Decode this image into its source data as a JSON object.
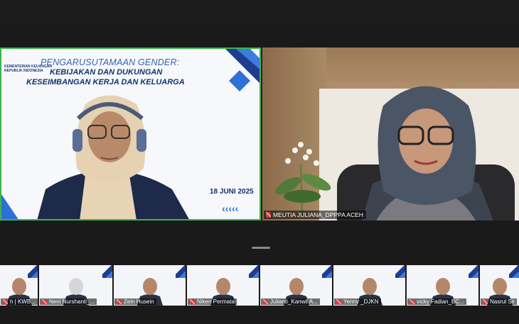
{
  "main_tiles": {
    "left": {
      "slide_line1": "PENGARUSUTAMAAN GENDER:",
      "slide_line2": "KEBIJAKAN DAN DUKUNGAN",
      "slide_line3": "KESEIMBANGAN KERJA DAN KELUARGA",
      "slide_logo": "KEMENTERIAN KEUANGAN",
      "slide_logo_sub": "REPUBLIK INDONESIA",
      "slide_date": "18 JUNI 2025"
    },
    "right": {
      "name": "MEUTIA JULIANA_DPPPA ACEH"
    }
  },
  "thumbnails": [
    {
      "name": "h | KWB..."
    },
    {
      "name": "Neni Nurshanti_..."
    },
    {
      "name": "Zein Husein"
    },
    {
      "name": "Niken Permata"
    },
    {
      "name": "Julianti_Kanwil A..."
    },
    {
      "name": "Yenny _DJKN"
    },
    {
      "name": "vicky Fadian_BC..."
    },
    {
      "name": "Nasrul Sir"
    }
  ],
  "colors": {
    "active_speaker_border": "#3bb54a",
    "slide_navy": "#14316f",
    "slide_blue": "#3a62b3",
    "mic_muted": "#e03b3b"
  }
}
